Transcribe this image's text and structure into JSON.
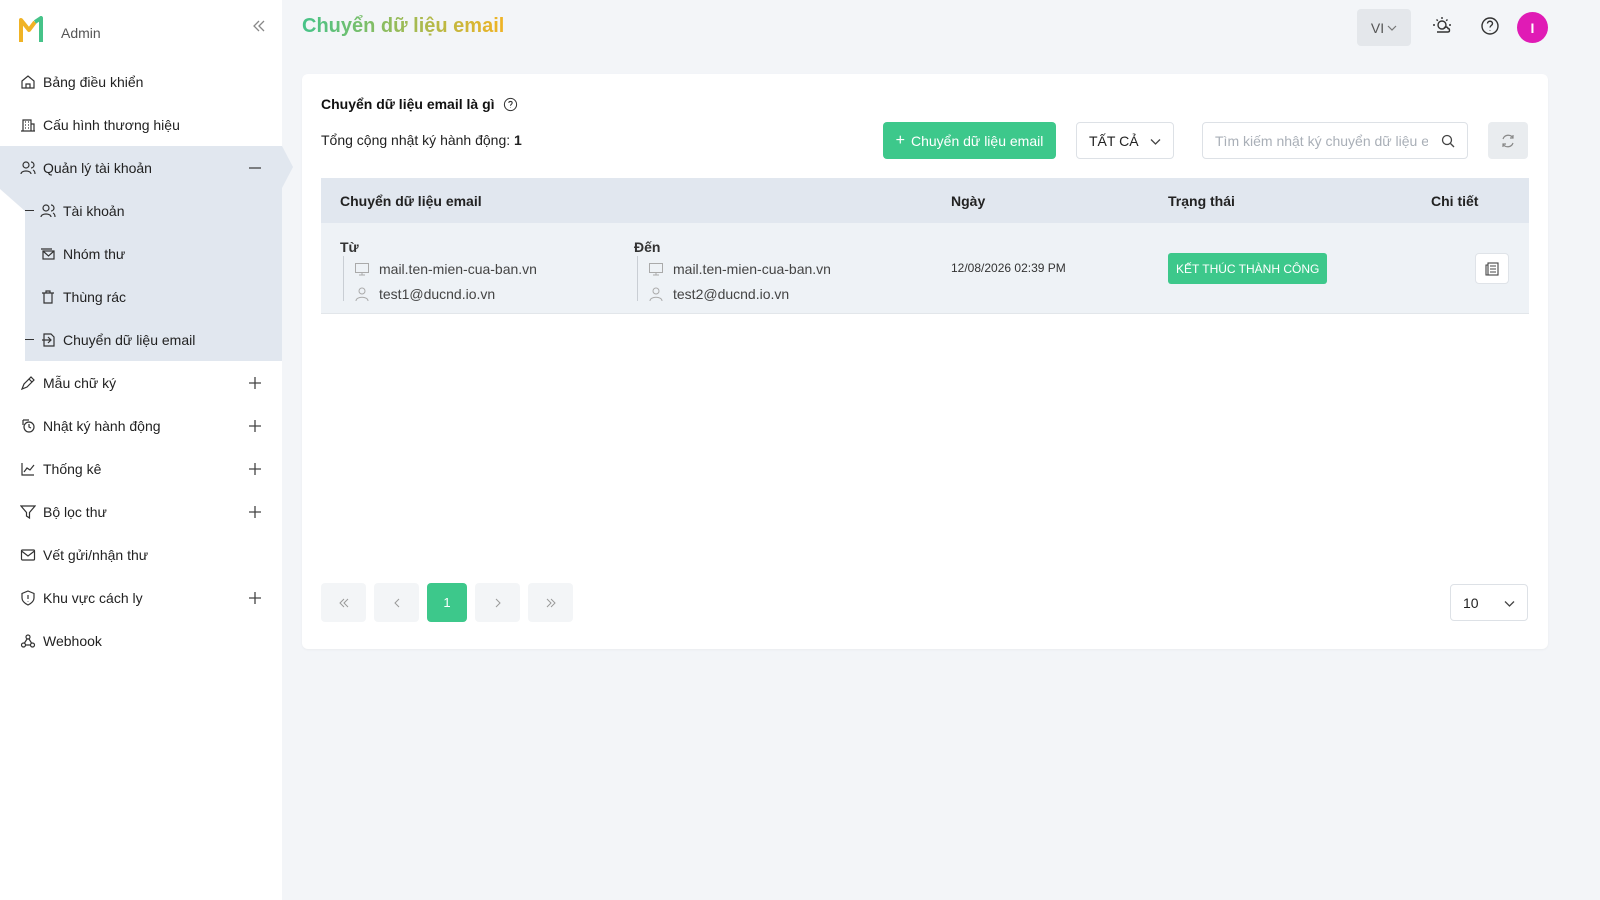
{
  "brand": {
    "role_label": "Admin",
    "accent": "#f0b325",
    "secondary": "#46c389"
  },
  "sidebar": {
    "items": [
      {
        "label": "Bảng điều khiển",
        "icon": "home-icon"
      },
      {
        "label": "Cấu hình thương hiệu",
        "icon": "building-icon"
      },
      {
        "label": "Quản lý tài khoản",
        "icon": "users-icon",
        "expanded": true
      },
      {
        "label": "Mẫu chữ ký",
        "icon": "pen-icon"
      },
      {
        "label": "Nhật ký hành động",
        "icon": "history-icon"
      },
      {
        "label": "Thống kê",
        "icon": "chart-icon"
      },
      {
        "label": "Bộ lọc thư",
        "icon": "filter-icon"
      },
      {
        "label": "Vết gửi/nhận thư",
        "icon": "mail-icon"
      },
      {
        "label": "Khu vực cách ly",
        "icon": "shield-icon"
      },
      {
        "label": "Webhook",
        "icon": "webhook-icon"
      }
    ],
    "subitems": [
      {
        "label": "Tài khoản",
        "icon": "users-icon"
      },
      {
        "label": "Nhóm thư",
        "icon": "mail-group-icon"
      },
      {
        "label": "Thùng rác",
        "icon": "trash-icon"
      },
      {
        "label": "Chuyển dữ liệu email",
        "icon": "migrate-icon"
      }
    ]
  },
  "header": {
    "title": "Chuyển dữ liệu email",
    "lang": "VI",
    "avatar_initial": "I",
    "avatar_color": "#e01bb5"
  },
  "main": {
    "section_title": "Chuyển dữ liệu email là gì",
    "total_label": "Tổng cộng nhật ký hành động:",
    "total_value": "1",
    "add_button": "Chuyển dữ liệu email",
    "filter_value": "TẤT CẢ",
    "search_placeholder": "Tìm kiếm nhật ký chuyển dữ liệu email",
    "columns": [
      "Chuyển dữ liệu email",
      "Ngày",
      "Trạng thái",
      "Chi tiết"
    ],
    "rows": [
      {
        "from_label": "Từ",
        "from_server": "mail.ten-mien-cua-ban.vn",
        "from_user": "test1@ducnd.io.vn",
        "to_label": "Đến",
        "to_server": "mail.ten-mien-cua-ban.vn",
        "to_user": "test2@ducnd.io.vn",
        "date": "12/08/2026 02:39 PM",
        "status": "KẾT THÚC THÀNH CÔNG",
        "status_color": "#3dc88b"
      }
    ],
    "pagination": {
      "current_page": "1",
      "page_size": "10"
    }
  }
}
